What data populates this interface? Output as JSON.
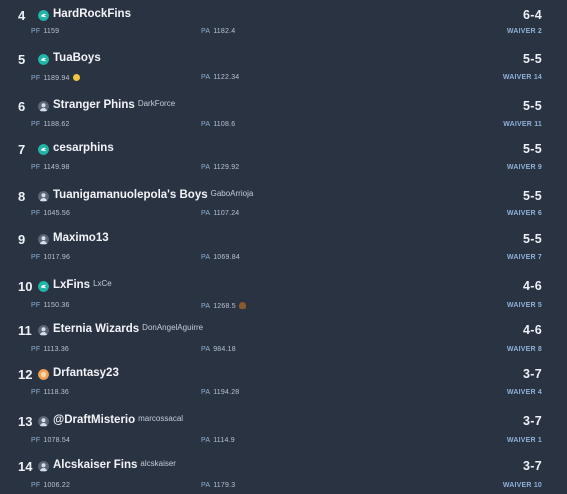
{
  "colors": {
    "background": "#2a3342",
    "label": "#8fb0d8"
  },
  "labels": {
    "pf": "PF",
    "pa": "PA",
    "waiver": "WAIVER"
  },
  "teams": [
    {
      "rank": "4",
      "name": "HardRockFins",
      "owner": "",
      "record": "6-4",
      "pf": "1159",
      "pf_emoji": "",
      "pa": "1182.4",
      "pa_emoji": "",
      "waiver": "2",
      "avatar_icon": "teal-dolphin-icon"
    },
    {
      "rank": "5",
      "name": "TuaBoys",
      "owner": "",
      "record": "5-5",
      "pf": "1189.94",
      "pf_emoji": "smile",
      "pa": "1122.34",
      "pa_emoji": "",
      "waiver": "14",
      "avatar_icon": "teal-dolphin-icon"
    },
    {
      "rank": "6",
      "name": "Stranger Phins",
      "owner": "DarkForce",
      "record": "5-5",
      "pf": "1188.62",
      "pf_emoji": "",
      "pa": "1108.6",
      "pa_emoji": "",
      "waiver": "11",
      "avatar_icon": "custom-avatar-icon"
    },
    {
      "rank": "7",
      "name": "cesarphins",
      "owner": "",
      "record": "5-5",
      "pf": "1149.98",
      "pf_emoji": "",
      "pa": "1129.92",
      "pa_emoji": "",
      "waiver": "9",
      "avatar_icon": "teal-dolphin-icon"
    },
    {
      "rank": "8",
      "name": "Tuanigamanuolepola's Boys",
      "owner": "GaboArrioja",
      "record": "5-5",
      "pf": "1045.56",
      "pf_emoji": "",
      "pa": "1107.24",
      "pa_emoji": "",
      "waiver": "6",
      "avatar_icon": "custom-avatar-icon"
    },
    {
      "rank": "9",
      "name": "Maximo13",
      "owner": "",
      "record": "5-5",
      "pf": "1017.96",
      "pf_emoji": "",
      "pa": "1069.84",
      "pa_emoji": "",
      "waiver": "7",
      "avatar_icon": "custom-avatar-icon"
    },
    {
      "rank": "10",
      "name": "LxFins",
      "owner": "LxCe",
      "record": "4-6",
      "pf": "1150.36",
      "pf_emoji": "",
      "pa": "1268.5",
      "pa_emoji": "poop",
      "waiver": "5",
      "avatar_icon": "teal-dolphin-icon"
    },
    {
      "rank": "11",
      "name": "Eternia Wizards",
      "owner": "DonAngelAguirre",
      "record": "4-6",
      "pf": "1113.36",
      "pf_emoji": "",
      "pa": "984.18",
      "pa_emoji": "",
      "waiver": "8",
      "avatar_icon": "custom-avatar-icon"
    },
    {
      "rank": "12",
      "name": "Drfantasy23",
      "owner": "",
      "record": "3-7",
      "pf": "1118.36",
      "pf_emoji": "",
      "pa": "1194.28",
      "pa_emoji": "",
      "waiver": "4",
      "avatar_icon": "orange-avatar-icon"
    },
    {
      "rank": "13",
      "name": "@DraftMisterio",
      "owner": "marcossacal",
      "record": "3-7",
      "pf": "1078.54",
      "pf_emoji": "",
      "pa": "1114.9",
      "pa_emoji": "",
      "waiver": "1",
      "avatar_icon": "custom-avatar-icon"
    },
    {
      "rank": "14",
      "name": "Alcskaiser Fins",
      "owner": "alcskaiser",
      "record": "3-7",
      "pf": "1006.22",
      "pf_emoji": "",
      "pa": "1179.3",
      "pa_emoji": "",
      "waiver": "10",
      "avatar_icon": "custom-avatar-icon"
    }
  ]
}
